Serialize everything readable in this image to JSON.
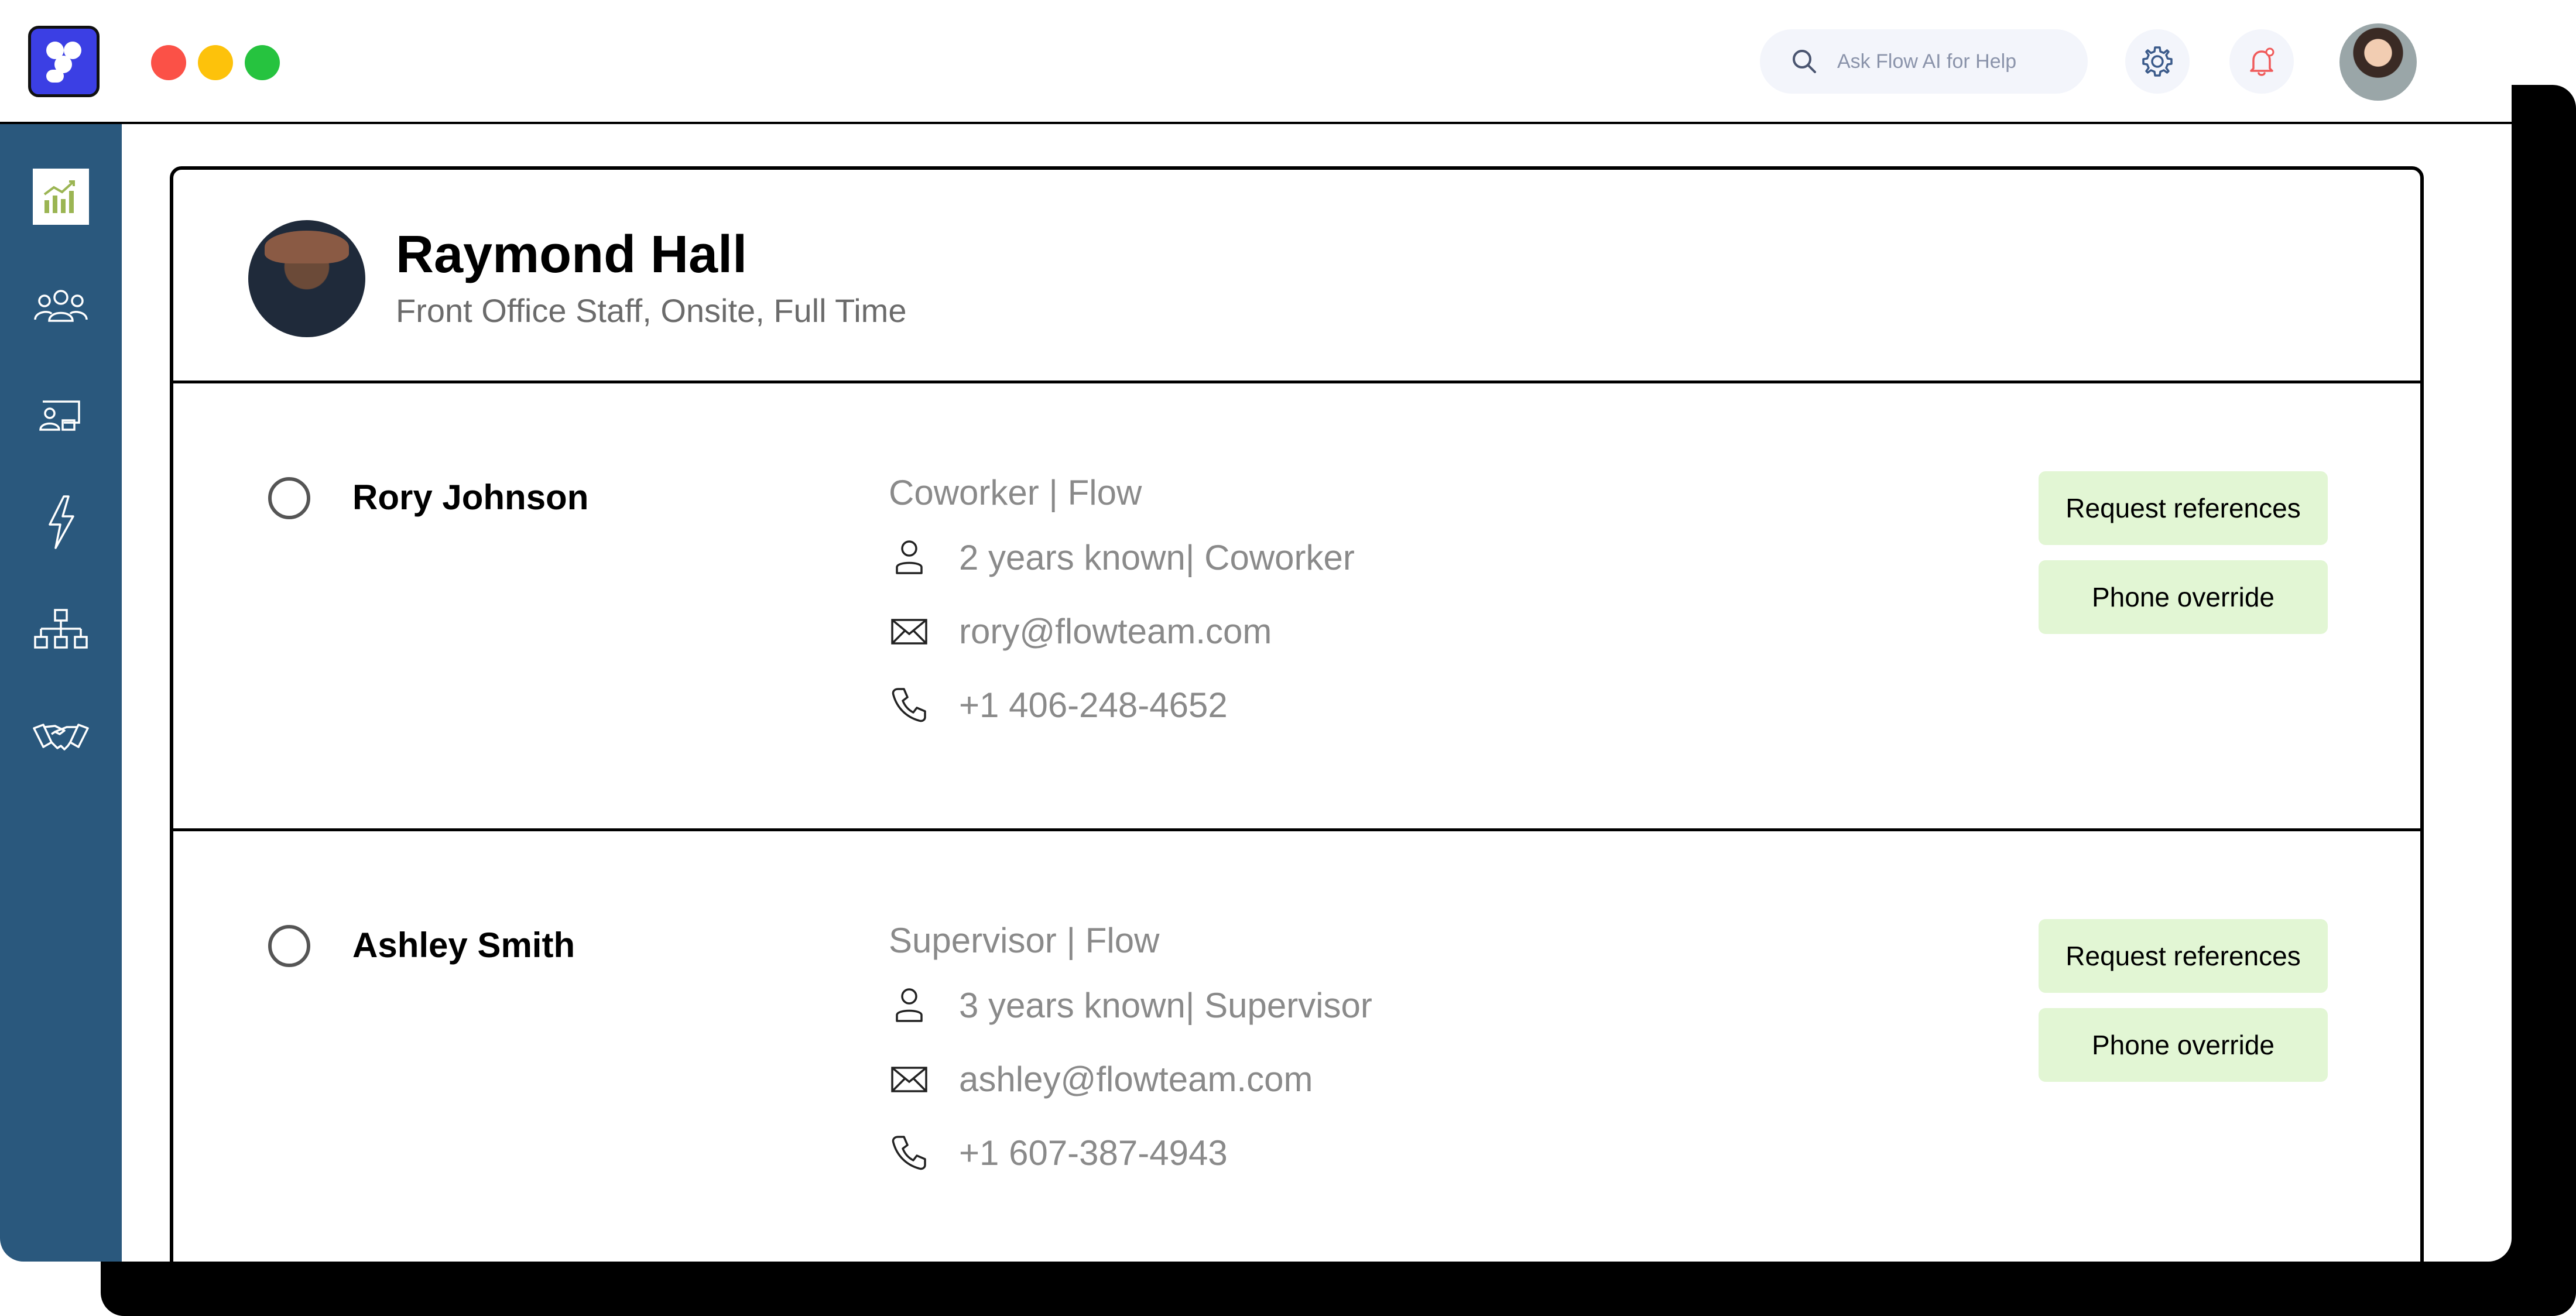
{
  "search": {
    "placeholder": "Ask Flow AI for Help"
  },
  "icons": {
    "app_logo": "flow-logo",
    "search": "search-icon",
    "settings": "gear-icon",
    "notifications": "bell-icon",
    "sidebar": [
      "analytics-icon",
      "team-icon",
      "presentation-icon",
      "lightning-icon",
      "org-chart-icon",
      "handshake-icon"
    ]
  },
  "colors": {
    "brand": "#3b3fe4",
    "sidebar": "#2a587d",
    "action_button_bg": "#e2f6d4",
    "notification_accent": "#f05a5a"
  },
  "profile": {
    "name": "Raymond Hall",
    "subtitle": "Front Office Staff, Onsite, Full Time"
  },
  "references": [
    {
      "name": "Rory Johnson",
      "role": "Coworker | Flow",
      "known": "2 years known| Coworker",
      "email": "rory@flowteam.com",
      "phone": "+1 406-248-4652",
      "request_label": "Request references",
      "override_label": "Phone override"
    },
    {
      "name": "Ashley Smith",
      "role": "Supervisor | Flow",
      "known": "3 years known| Supervisor",
      "email": "ashley@flowteam.com",
      "phone": "+1 607-387-4943",
      "request_label": "Request references",
      "override_label": "Phone override"
    }
  ]
}
